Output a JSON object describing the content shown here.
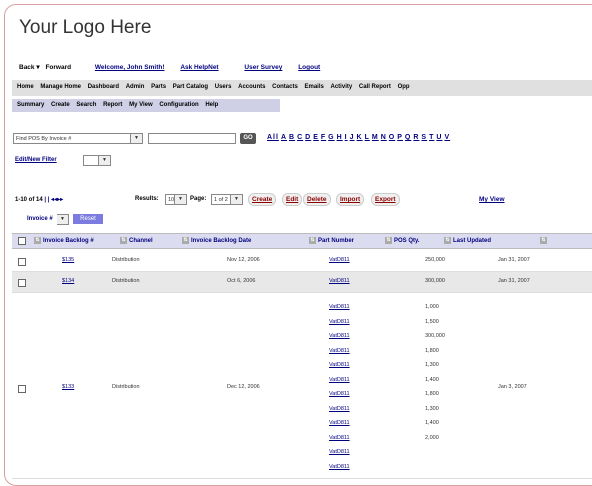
{
  "logo": "Your Logo Here",
  "topnav": {
    "back": "Back",
    "forward": "Forward",
    "welcome": "Welcome, John Smith!",
    "ask": "Ask HelpNet",
    "survey": "User Survey",
    "logout": "Logout"
  },
  "menu": [
    "Home",
    "Manage Home",
    "Dashboard",
    "Admin",
    "Parts",
    "Part Catalog",
    "Users",
    "Accounts",
    "Contacts",
    "Emails",
    "Activity",
    "Call Report",
    "Opp"
  ],
  "submenu": [
    "Summary",
    "Create",
    "Search",
    "Report",
    "My View",
    "Configuration",
    "Help"
  ],
  "search": {
    "select_value": "Find POS By Invoice #",
    "go_label": "GO"
  },
  "alphabet": [
    "All",
    "A",
    "B",
    "C",
    "D",
    "E",
    "F",
    "G",
    "H",
    "I",
    "J",
    "K",
    "L",
    "M",
    "N",
    "O",
    "P",
    "Q",
    "R",
    "S",
    "T",
    "U",
    "V"
  ],
  "edit_filter": "Edit/New Filter",
  "pager": {
    "range": "1-10 of 14",
    "results_label": "Results:",
    "results_value": "10",
    "page_label": "Page:",
    "page_value": "1 of 2",
    "actions": [
      "Create",
      "Edit",
      "Delete",
      "Import",
      "Export"
    ],
    "my_view": "My View"
  },
  "filter": {
    "label": "Invoice #",
    "reset": "Reset"
  },
  "columns": [
    "Invoice Backlog #",
    "Channel",
    "Invoice Backlog Date",
    "Part Number",
    "POS Qty.",
    "Last Updated"
  ],
  "rows": [
    {
      "invoice": "$135",
      "channel": "Distribution",
      "date": "Nov 12, 2006",
      "parts": [
        "VatD811"
      ],
      "qty": [
        "250,000"
      ],
      "updated": "Jan 31, 2007"
    },
    {
      "invoice": "$134",
      "channel": "Distribution",
      "date": "Oct 6, 2006",
      "parts": [
        "VatD811"
      ],
      "qty": [
        "300,000"
      ],
      "updated": "Jan 31, 2007"
    },
    {
      "invoice": "$133",
      "channel": "Distribution",
      "date": "Dec 12, 2006",
      "parts": [
        "VatD811",
        "VatD811",
        "VatD811",
        "VatD811",
        "VatD811",
        "VatD811",
        "VatD811",
        "VatD811",
        "VatD811",
        "VatD811",
        "VatD811",
        "VatD811"
      ],
      "qty": [
        "1,000",
        "1,500",
        "300,000",
        "1,800",
        "1,300",
        "1,400",
        "1,800",
        "1,300",
        "1,400",
        "2,000"
      ],
      "updated": "Jan 3, 2007"
    }
  ]
}
